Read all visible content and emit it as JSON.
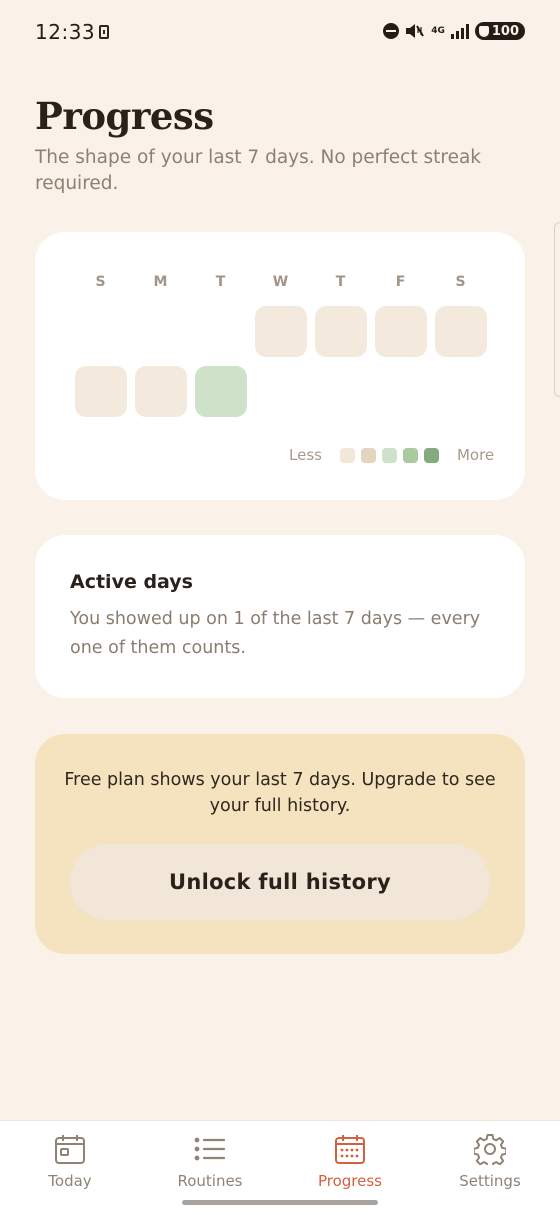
{
  "status_bar": {
    "time": "12:33",
    "network": "4G",
    "battery": "100"
  },
  "header": {
    "title": "Progress",
    "subtitle": "The shape of your last 7 days. No perfect streak required."
  },
  "heatmap": {
    "day_labels": [
      "S",
      "M",
      "T",
      "W",
      "T",
      "F",
      "S"
    ],
    "week1": [
      {
        "day": "W",
        "active": false
      },
      {
        "day": "T",
        "active": false
      },
      {
        "day": "F",
        "active": false
      },
      {
        "day": "S",
        "active": false
      }
    ],
    "week2": [
      {
        "day": "S",
        "active": false
      },
      {
        "day": "M",
        "active": false
      },
      {
        "day": "T",
        "active": true
      }
    ],
    "legend": {
      "less_label": "Less",
      "more_label": "More",
      "swatch_colors": [
        "#f1e7db",
        "#e2d6bf",
        "#cde2c8",
        "#a9cb9f",
        "#86aa80"
      ]
    },
    "colors": {
      "inactive": "#f3e9dd",
      "active": "#cde2c8"
    }
  },
  "active_days": {
    "title": "Active days",
    "body": "You showed up on 1 of the last 7 days — every one of them counts."
  },
  "upgrade": {
    "text": "Free plan shows your last 7 days. Upgrade to see your full history.",
    "button_label": "Unlock full history"
  },
  "nav": {
    "items": [
      {
        "label": "Today",
        "icon": "calendar-today-icon",
        "active": false
      },
      {
        "label": "Routines",
        "icon": "list-icon",
        "active": false
      },
      {
        "label": "Progress",
        "icon": "calendar-grid-icon",
        "active": true
      },
      {
        "label": "Settings",
        "icon": "gear-icon",
        "active": false
      }
    ],
    "active_color": "#d6603e"
  }
}
